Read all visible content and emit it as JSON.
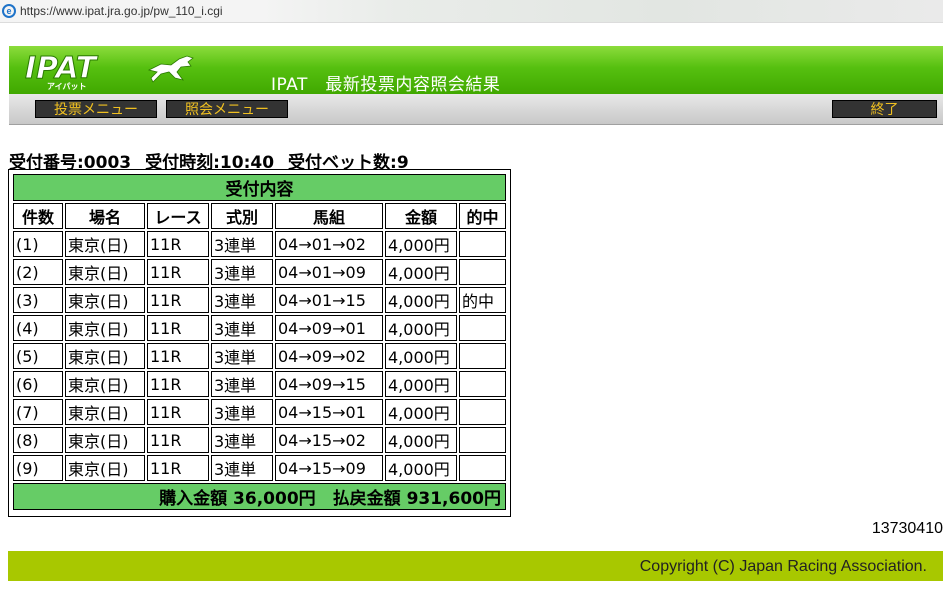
{
  "browser": {
    "url": "https://www.ipat.jra.go.jp/pw_110_i.cgi"
  },
  "header": {
    "logo_text": "IPAT",
    "logo_sub": "アイパット",
    "title": "IPAT　最新投票内容照会結果"
  },
  "nav": {
    "bet_menu": "投票メニュー",
    "inquiry_menu": "照会メニュー",
    "end": "終了"
  },
  "summary": {
    "receipt_no": "受付番号:0003",
    "receipt_time": "受付時刻:10:40",
    "bet_count": "受付ベット数:9"
  },
  "table": {
    "caption": "受付内容",
    "headers": [
      "件数",
      "場名",
      "レース",
      "式別",
      "馬組",
      "金額",
      "的中"
    ],
    "rows": [
      [
        "(1)",
        "東京(日)",
        "11R",
        "3連単",
        "04→01→02",
        "4,000円",
        ""
      ],
      [
        "(2)",
        "東京(日)",
        "11R",
        "3連単",
        "04→01→09",
        "4,000円",
        ""
      ],
      [
        "(3)",
        "東京(日)",
        "11R",
        "3連単",
        "04→01→15",
        "4,000円",
        "的中"
      ],
      [
        "(4)",
        "東京(日)",
        "11R",
        "3連単",
        "04→09→01",
        "4,000円",
        ""
      ],
      [
        "(5)",
        "東京(日)",
        "11R",
        "3連単",
        "04→09→02",
        "4,000円",
        ""
      ],
      [
        "(6)",
        "東京(日)",
        "11R",
        "3連単",
        "04→09→15",
        "4,000円",
        ""
      ],
      [
        "(7)",
        "東京(日)",
        "11R",
        "3連単",
        "04→15→01",
        "4,000円",
        ""
      ],
      [
        "(8)",
        "東京(日)",
        "11R",
        "3連単",
        "04→15→02",
        "4,000円",
        ""
      ],
      [
        "(9)",
        "東京(日)",
        "11R",
        "3連単",
        "04→15→09",
        "4,000円",
        ""
      ]
    ],
    "total": "購入金額 36,000円　払戻金額 931,600円"
  },
  "receipt_code": "13730410",
  "footer": {
    "copyright": "Copyright (C) Japan Racing Association."
  },
  "colors": {
    "header_green": "#56c010",
    "band_green": "#66cc66",
    "footer_green": "#a8c800",
    "nav_text": "#f0c020"
  }
}
